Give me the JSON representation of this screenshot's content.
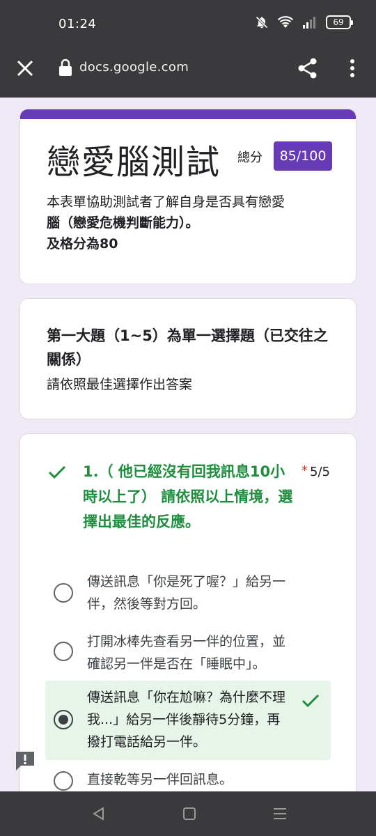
{
  "status_bar": {
    "time": "01:24",
    "battery": "69"
  },
  "browser": {
    "url": "docs.google.com",
    "icons": [
      "close-icon",
      "lock-icon",
      "share-icon",
      "more-vert-icon"
    ]
  },
  "form": {
    "title": "戀愛腦測試",
    "score_label": "總分",
    "score_value": "85/100",
    "description_line1": "本表單協助測試者了解自身是否具有戀愛",
    "description_line2": "腦（戀愛危機判斷能力）。",
    "description_line3": "及格分為80",
    "accent_color": "#673ab7"
  },
  "section": {
    "title": "第一大題（1~5）為單一選擇題（已交往之關係）",
    "description": "請依照最佳選擇作出答案"
  },
  "question": {
    "text": "1.（ 他已經沒有回我訊息10小時以上了） 請依照以上情境，選擇出最佳的反應。",
    "required_mark": "*",
    "score": "5/5",
    "correct_color": "#1e8e3e",
    "options": [
      {
        "label": "傳送訊息「你是死了喔？」給另一伴，然後等對方回。",
        "selected": false
      },
      {
        "label": "打開冰棒先查看另一伴的位置，並確認另一伴是否在「睡眠中」。",
        "selected": false
      },
      {
        "label": "傳送訊息「你在尬嘛？為什麼不理我...」給另一伴後靜待5分鐘，再撥打電話給另一伴。",
        "selected": true,
        "correct": true
      },
      {
        "label": "直接乾等另一伴回訊息。",
        "selected": false
      }
    ]
  }
}
